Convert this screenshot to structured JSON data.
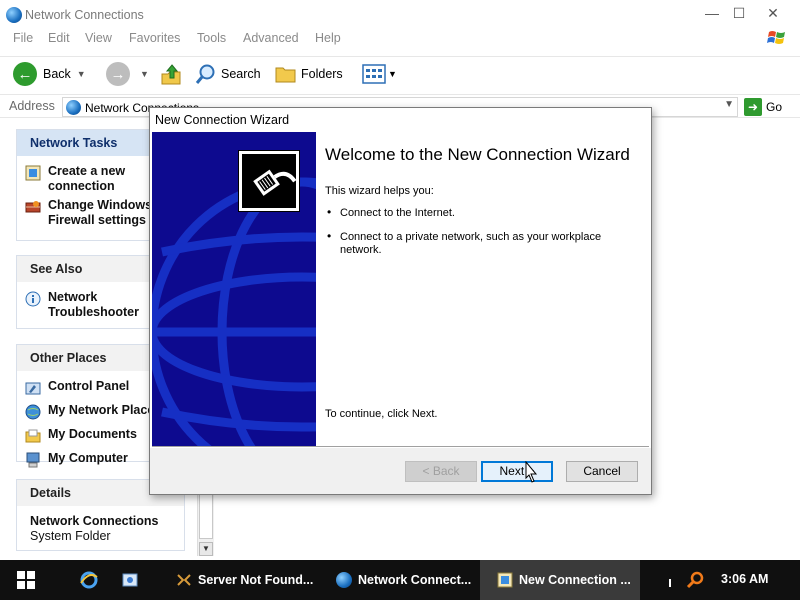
{
  "window": {
    "title": "Network Connections",
    "minimize_glyph": "—",
    "maximize_glyph": "☐",
    "close_glyph": "✕"
  },
  "menu": [
    "File",
    "Edit",
    "View",
    "Favorites",
    "Tools",
    "Advanced",
    "Help"
  ],
  "toolbar": {
    "back_label": "Back",
    "search_label": "Search",
    "folders_label": "Folders"
  },
  "address": {
    "label": "Address",
    "value": "Network Connections",
    "go_label": "Go"
  },
  "taskpane": {
    "network_tasks": {
      "title": "Network Tasks",
      "items": [
        "Create a new connection",
        "Change Windows Firewall settings"
      ]
    },
    "see_also": {
      "title": "See Also",
      "items": [
        "Network Troubleshooter"
      ]
    },
    "other_places": {
      "title": "Other Places",
      "items": [
        "Control Panel",
        "My Network Places",
        "My Documents",
        "My Computer"
      ]
    },
    "details": {
      "title": "Details",
      "name": "Network Connections",
      "type": "System Folder"
    }
  },
  "wizard": {
    "title": "New Connection Wizard",
    "heading": "Welcome to the New Connection Wizard",
    "intro": "This wizard helps you:",
    "bullets": [
      "Connect to the Internet.",
      "Connect to a private network, such as your workplace network."
    ],
    "continue_text": "To continue, click Next.",
    "back_label": "< Back",
    "next_label": "Next >",
    "cancel_label": "Cancel"
  },
  "taskbar": {
    "items": [
      "Server Not Found...",
      "Network Connect...",
      "New Connection ..."
    ],
    "clock": "3:06 AM"
  },
  "colors": {
    "wizard_banner": "#0d0a8f",
    "taskpane_header_active": "#d6e4f4",
    "taskbar": "#101010"
  }
}
